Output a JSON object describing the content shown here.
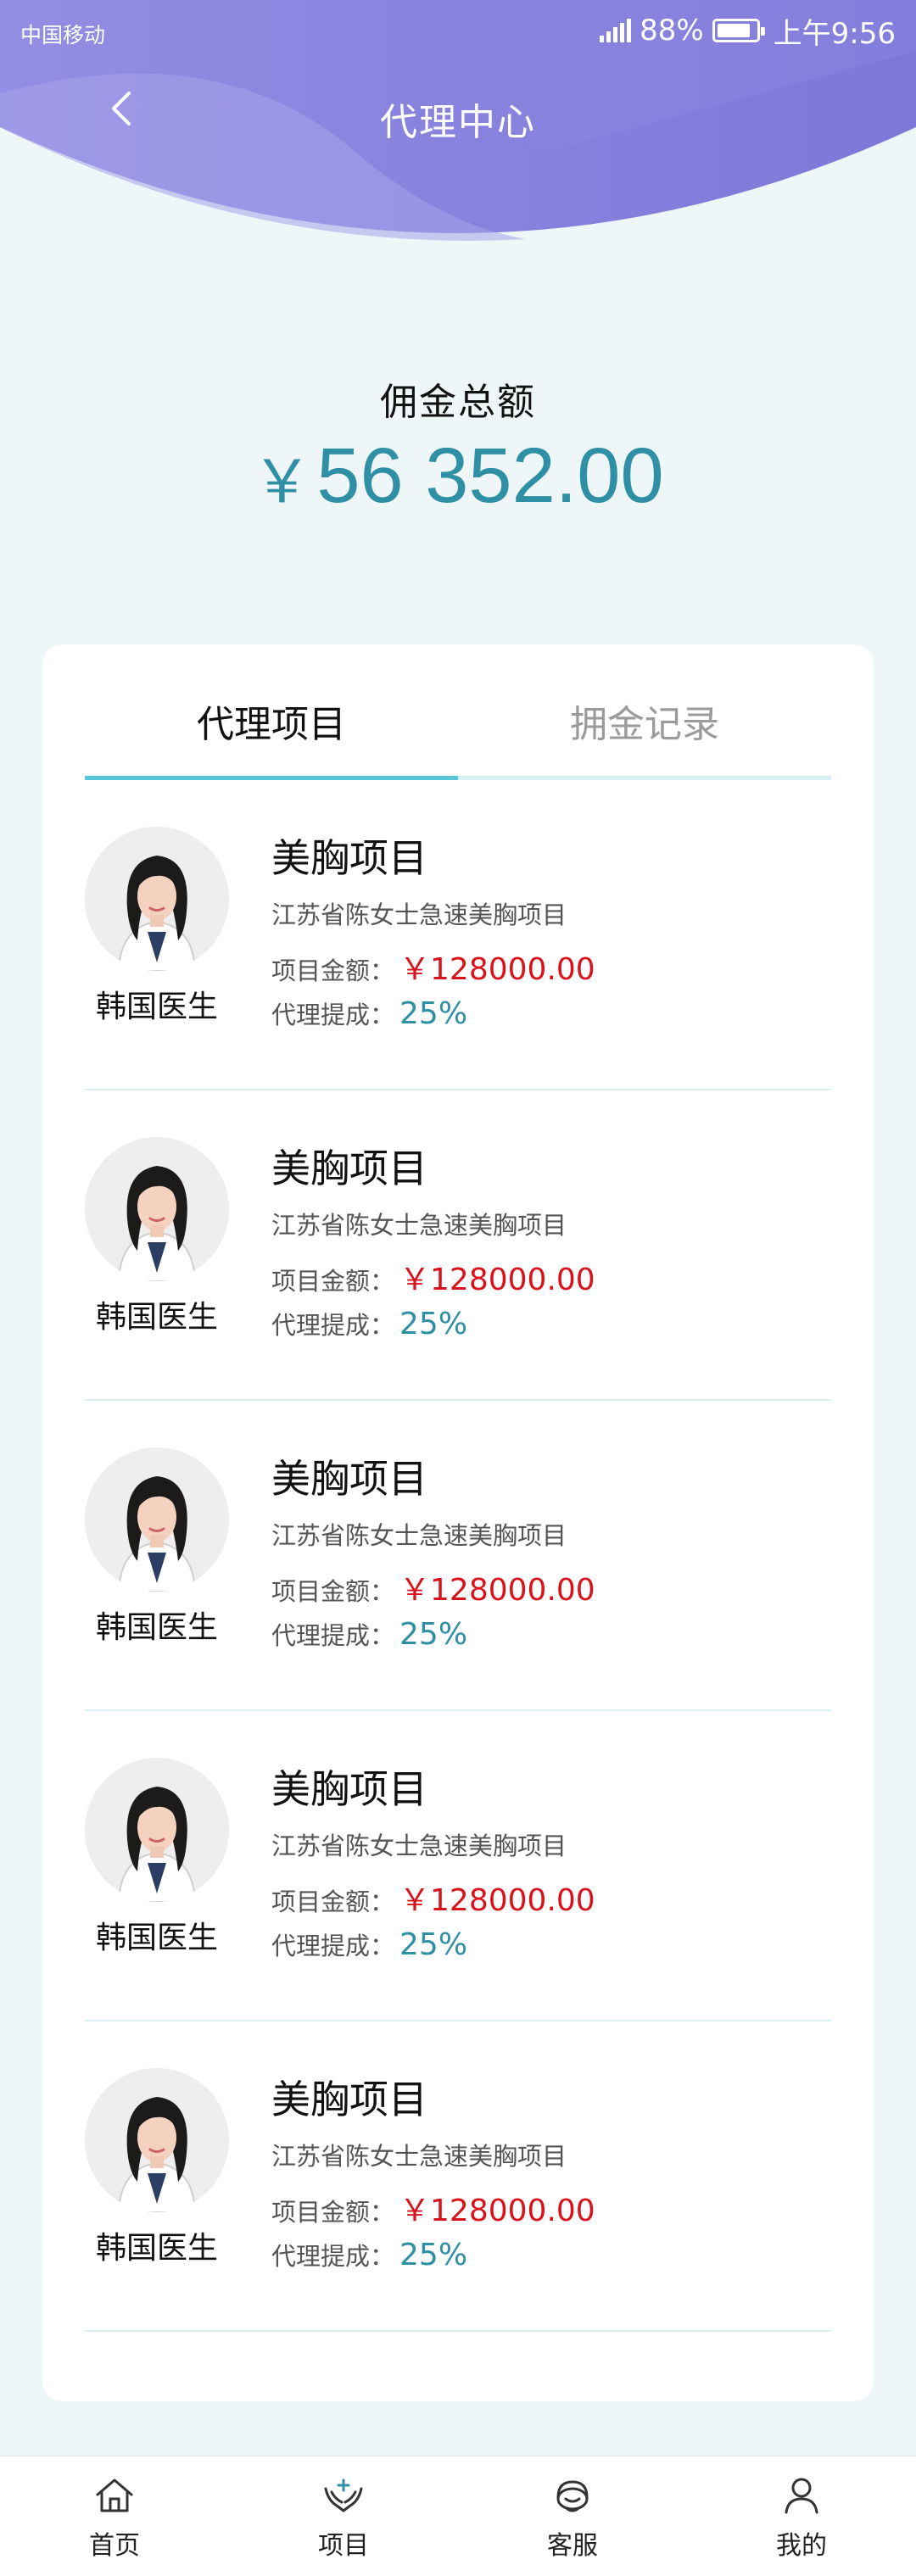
{
  "status_bar": {
    "carrier": "中国移动",
    "battery": "88%",
    "battery_level": 0.88,
    "time": "上午9:56"
  },
  "header": {
    "title": "代理中心",
    "gradient_colors": [
      "#8e88e0",
      "#7f7bd9"
    ]
  },
  "summary": {
    "label": "佣金总额",
    "currency": "￥",
    "amount": "56 352.00"
  },
  "tabs": [
    {
      "label": "代理项目",
      "active": true
    },
    {
      "label": "拥金记录",
      "active": false
    }
  ],
  "items": [
    {
      "doctor": "韩国医生",
      "title": "美胸项目",
      "desc": "江苏省陈女士急速美胸项目",
      "amount_label": "项目金额：",
      "amount": "￥128000.00",
      "rate_label": "代理提成：",
      "rate": "25%"
    },
    {
      "doctor": "韩国医生",
      "title": "美胸项目",
      "desc": "江苏省陈女士急速美胸项目",
      "amount_label": "项目金额：",
      "amount": "￥128000.00",
      "rate_label": "代理提成：",
      "rate": "25%"
    },
    {
      "doctor": "韩国医生",
      "title": "美胸项目",
      "desc": "江苏省陈女士急速美胸项目",
      "amount_label": "项目金额：",
      "amount": "￥128000.00",
      "rate_label": "代理提成：",
      "rate": "25%"
    },
    {
      "doctor": "韩国医生",
      "title": "美胸项目",
      "desc": "江苏省陈女士急速美胸项目",
      "amount_label": "项目金额：",
      "amount": "￥128000.00",
      "rate_label": "代理提成：",
      "rate": "25%"
    },
    {
      "doctor": "韩国医生",
      "title": "美胸项目",
      "desc": "江苏省陈女士急速美胸项目",
      "amount_label": "项目金额：",
      "amount": "￥128000.00",
      "rate_label": "代理提成：",
      "rate": "25%"
    }
  ],
  "bottom_nav": [
    {
      "label": "首页",
      "icon": "home-icon"
    },
    {
      "label": "项目",
      "icon": "hands-icon"
    },
    {
      "label": "客服",
      "icon": "headset-icon"
    },
    {
      "label": "我的",
      "icon": "user-icon"
    }
  ],
  "colors": {
    "accent": "#2f8fa4",
    "tab_indicator": "#56c6d8",
    "price_red": "#d8131b",
    "background": "#eef6f8"
  }
}
